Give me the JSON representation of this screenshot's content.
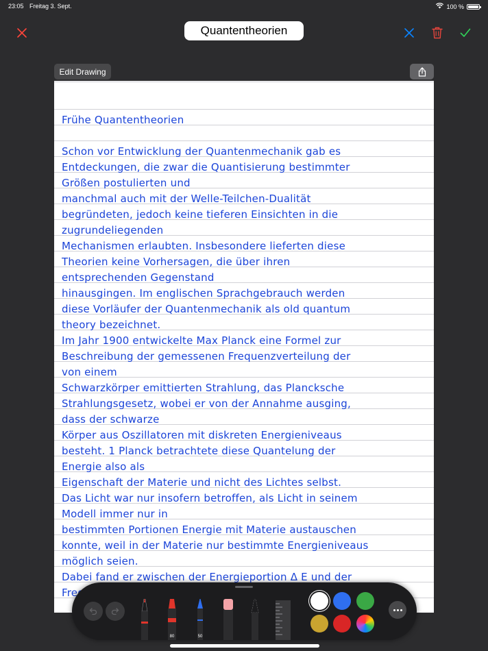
{
  "status_bar": {
    "time": "23:05",
    "date": "Freitag 3. Sept.",
    "battery": "100 %"
  },
  "header": {
    "title": "Quantentheorien"
  },
  "canvas": {
    "edit_drawing_label": "Edit Drawing",
    "lines": [
      "",
      "Frühe Quantentheorien",
      "",
      "Schon vor Entwicklung der Quantenmechanik gab es",
      "Entdeckungen, die zwar die Quantisierung bestimmter",
      "Größen postulierten und",
      "manchmal auch mit der Welle-Teilchen-Dualität",
      "begründeten, jedoch keine tieferen Einsichten in die",
      "zugrundeliegenden",
      "Mechanismen erlaubten. Insbesondere lieferten diese",
      "Theorien keine Vorhersagen, die über ihren",
      "entsprechenden Gegenstand",
      "hinausgingen. Im englischen Sprachgebrauch werden",
      "diese Vorläufer der Quantenmechanik als old quantum",
      "theory bezeichnet.",
      "Im Jahr 1900 entwickelte Max Planck eine Formel zur",
      "Beschreibung der gemessenen Frequenzverteilung der",
      "von einem",
      "Schwarzkörper emittierten Strahlung, das Plancksche",
      "Strahlungsgesetz, wobei er von der Annahme ausging,",
      "dass der schwarze",
      "Körper aus Oszillatoren mit diskreten Energieniveaus",
      "besteht. 1 Planck betrachtete diese Quantelung der",
      "Energie also als",
      "Eigenschaft der Materie und nicht des Lichtes selbst.",
      "Das Licht war nur insofern betroffen, als Licht in seinem",
      "Modell immer nur in",
      "bestimmten Portionen Energie mit Materie austauschen",
      "konnte, weil in der Materie nur bestimmte Energieniveaus",
      "möglich seien.",
      "Dabei fand er zwischen der Energieportion Δ E und der",
      "Frequenz ν des Lichts den Zusammenhang Δ E = hν"
    ]
  },
  "toolbar": {
    "marker_size": "80",
    "pencil_size": "50"
  },
  "colors": {
    "background": "#2c2c2e",
    "ink": "#1b44d8",
    "close_red": "#ff453a",
    "delete_red": "#e8453c",
    "confirm_green": "#30d158",
    "clear_blue": "#0a84ff",
    "swatches": [
      "#ffffff",
      "#2f6ff0",
      "#3aa845",
      "#c9a430",
      "#d92626",
      "multicolor"
    ]
  }
}
